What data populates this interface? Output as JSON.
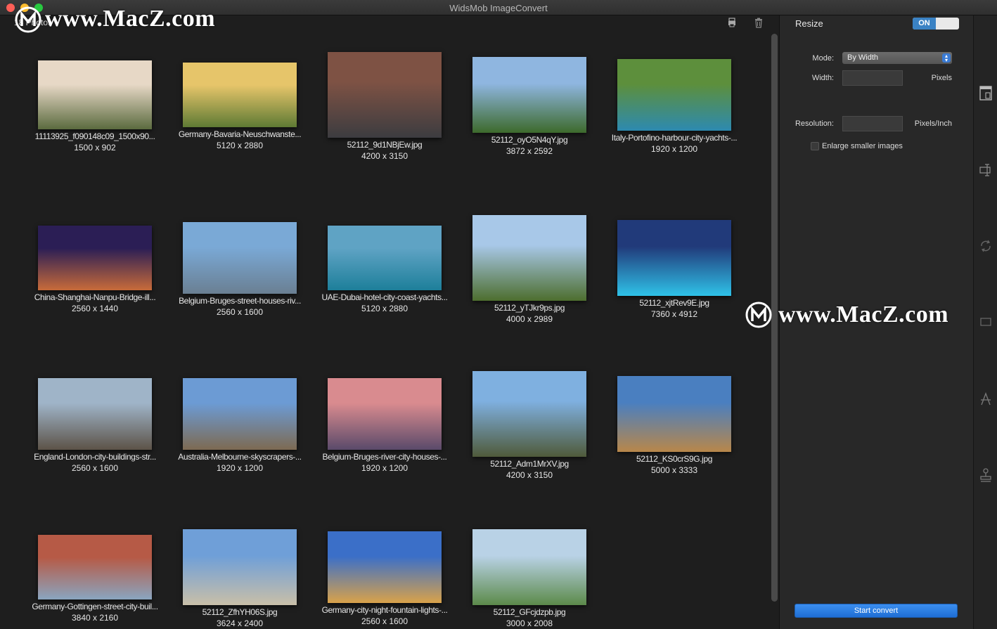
{
  "window": {
    "title": "WidsMob ImageConvert"
  },
  "toolbar": {
    "photo_count": "18 Photos",
    "export_icon": "printer-icon",
    "delete_icon": "trash-icon"
  },
  "photos": [
    {
      "name": "11113925_f090148c09_1500x90...",
      "dims": "1500 x 902",
      "colors": [
        "#e7d8c6",
        "#5b6b3f"
      ]
    },
    {
      "name": "Germany-Bavaria-Neuschwanste...",
      "dims": "5120 x 2880",
      "colors": [
        "#e6c56a",
        "#5e7a34"
      ]
    },
    {
      "name": "52112_9d1NBjEw.jpg",
      "dims": "4200 x 3150",
      "colors": [
        "#7e5244",
        "#3c3c40"
      ]
    },
    {
      "name": "52112_oyO5N4qY.jpg",
      "dims": "3872 x 2592",
      "colors": [
        "#8fb6e0",
        "#3d6a2c"
      ]
    },
    {
      "name": "Italy-Portofino-harbour-city-yachts-...",
      "dims": "1920 x 1200",
      "colors": [
        "#5d8f3c",
        "#2d8ab0"
      ]
    },
    {
      "name": "China-Shanghai-Nanpu-Bridge-ill...",
      "dims": "2560 x 1440",
      "colors": [
        "#2b1e55",
        "#c86b3a"
      ]
    },
    {
      "name": "Belgium-Bruges-street-houses-riv...",
      "dims": "2560 x 1600",
      "colors": [
        "#7aa9d6",
        "#6a7f92"
      ]
    },
    {
      "name": "UAE-Dubai-hotel-city-coast-yachts...",
      "dims": "5120 x 2880",
      "colors": [
        "#5fa3c4",
        "#1d7f9a"
      ]
    },
    {
      "name": "52112_yTJkr9ps.jpg",
      "dims": "4000 x 2989",
      "colors": [
        "#a8c8e8",
        "#4d6e2e"
      ]
    },
    {
      "name": "52112_xjtRev9E.jpg",
      "dims": "7360 x 4912",
      "colors": [
        "#213a7a",
        "#2fc2e8"
      ]
    },
    {
      "name": "England-London-city-buildings-str...",
      "dims": "2560 x 1600",
      "colors": [
        "#9fb4c8",
        "#5d5348"
      ]
    },
    {
      "name": "Australia-Melbourne-skyscrapers-...",
      "dims": "1920 x 1200",
      "colors": [
        "#6c9bd4",
        "#7d6a52"
      ]
    },
    {
      "name": "Belgium-Bruges-river-city-houses-...",
      "dims": "1920 x 1200",
      "colors": [
        "#d98b8f",
        "#5a4a6a"
      ]
    },
    {
      "name": "52112_Adm1MrXV.jpg",
      "dims": "4200 x 3150",
      "colors": [
        "#7fb0e0",
        "#4f5a3a"
      ]
    },
    {
      "name": "52112_KS0crS9G.jpg",
      "dims": "5000 x 3333",
      "colors": [
        "#4a7fc0",
        "#b8874a"
      ]
    },
    {
      "name": "Germany-Gottingen-street-city-buil...",
      "dims": "3840 x 2160",
      "colors": [
        "#b65a46",
        "#8aa5c0"
      ]
    },
    {
      "name": "52112_ZfhYH06S.jpg",
      "dims": "3624 x 2400",
      "colors": [
        "#6f9fd8",
        "#c9bfa8"
      ]
    },
    {
      "name": "Germany-city-night-fountain-lights-...",
      "dims": "2560 x 1600",
      "colors": [
        "#3b6fc8",
        "#d9a24a"
      ]
    },
    {
      "name": "52112_GFcjdzpb.jpg",
      "dims": "3000 x 2008",
      "colors": [
        "#b9d2e6",
        "#5c8a4a"
      ]
    }
  ],
  "panel": {
    "title": "Resize",
    "toggle_label": "ON",
    "mode_label": "Mode:",
    "mode_value": "By Width",
    "width_label": "Width:",
    "width_unit": "Pixels",
    "width_value": "",
    "resolution_label": "Resolution:",
    "resolution_unit": "Pixels/Inch",
    "resolution_value": "",
    "enlarge_label": "Enlarge smaller images",
    "start_label": "Start convert"
  },
  "sidebar_tools": [
    "resize-icon",
    "crop-icon",
    "rotate-icon",
    "frame-icon",
    "text-watermark-icon",
    "stamp-icon"
  ],
  "watermark": {
    "text": "www.MacZ.com"
  },
  "colors": {
    "accent": "#3a82c4",
    "button": "#1f6ed4",
    "background": "#1e1e1e",
    "panel": "#282828"
  }
}
